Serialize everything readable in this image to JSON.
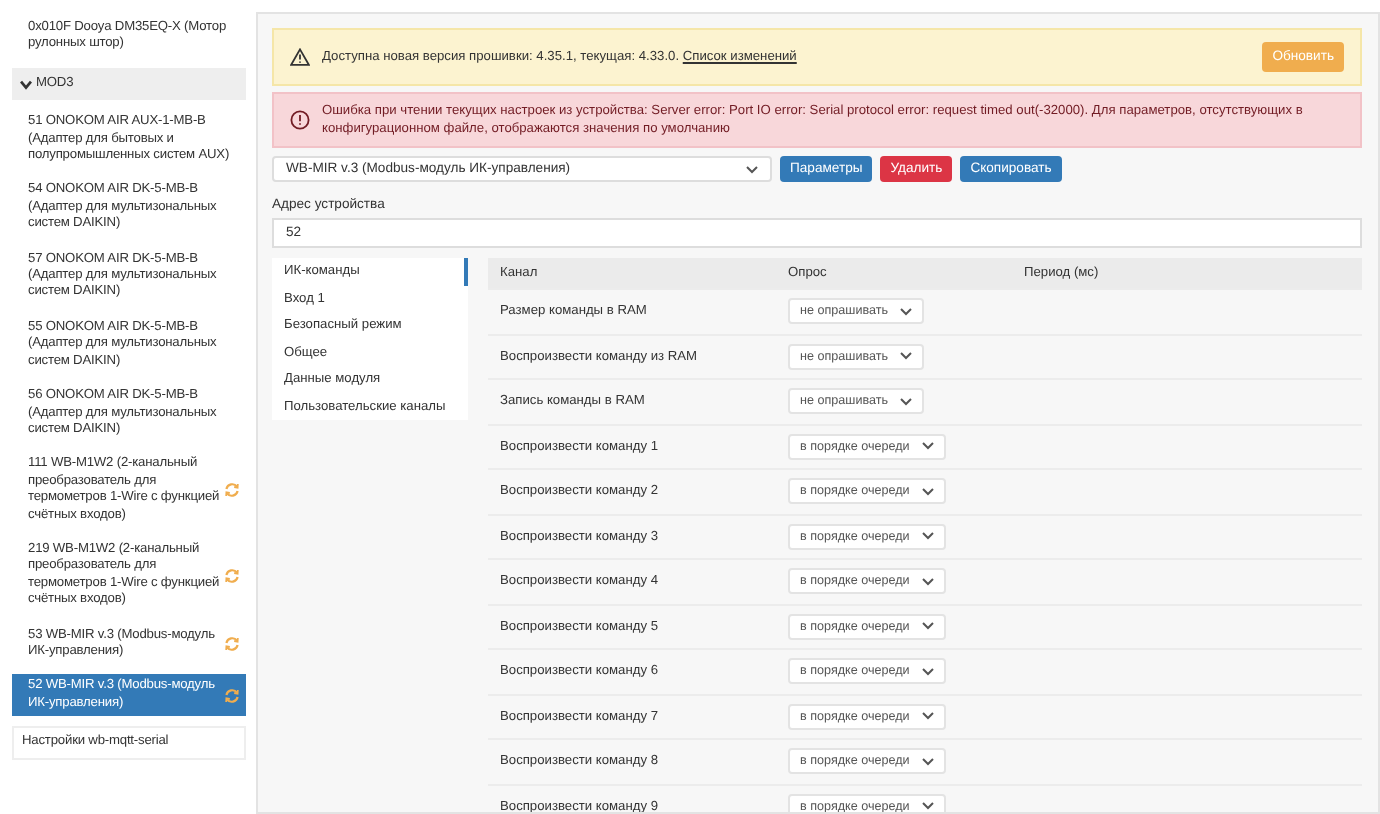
{
  "sidebar": {
    "items": [
      {
        "kind": "device",
        "label": "0x010F Dooya DM35EQ-X (Мотор рулонных штор)",
        "selected": false,
        "syncing": false
      },
      {
        "kind": "group",
        "label": "MOD3",
        "expanded": true,
        "selected": false,
        "syncing": false
      },
      {
        "kind": "device",
        "label": "51 ONOKOM AIR AUX-1-MB-B (Адаптер для бытовых и полупромышленных систем AUX)",
        "selected": false,
        "syncing": false
      },
      {
        "kind": "device",
        "label": "54 ONOKOM AIR DK-5-MB-B (Адаптер для мультизональных систем DAIKIN)",
        "selected": false,
        "syncing": false
      },
      {
        "kind": "device",
        "label": "57 ONOKOM AIR DK-5-MB-B (Адаптер для мультизональных систем DAIKIN)",
        "selected": false,
        "syncing": false
      },
      {
        "kind": "device",
        "label": "55 ONOKOM AIR DK-5-MB-B (Адаптер для мультизональных систем DAIKIN)",
        "selected": false,
        "syncing": false
      },
      {
        "kind": "device",
        "label": "56 ONOKOM AIR DK-5-MB-B (Адаптер для мультизональных систем DAIKIN)",
        "selected": false,
        "syncing": false
      },
      {
        "kind": "device",
        "label": "111 WB-M1W2 (2-канальный преобразователь для термометров 1-Wire с функцией счётных входов)",
        "selected": false,
        "syncing": true
      },
      {
        "kind": "device",
        "label": "219 WB-M1W2 (2-канальный преобразователь для термометров 1-Wire с функцией счётных входов)",
        "selected": false,
        "syncing": true
      },
      {
        "kind": "device",
        "label": "53 WB-MIR v.3 (Modbus-модуль ИК-управления)",
        "selected": false,
        "syncing": true
      },
      {
        "kind": "device",
        "label": "52 WB-MIR v.3 (Modbus-модуль ИК-управления)",
        "selected": true,
        "syncing": true
      },
      {
        "kind": "link",
        "label": "Настройки wb-mqtt-serial",
        "selected": false,
        "syncing": false
      }
    ]
  },
  "alerts": [
    {
      "kind": "warning",
      "text": "Доступна новая версия прошивки: 4.35.1, текущая: 4.33.0.",
      "link": "Список изменений",
      "button": "Обновить"
    },
    {
      "kind": "danger",
      "text": "Ошибка при чтении текущих настроек из устройства: Server error: Port IO error: Serial protocol error: request timed out(-32000). Для параметров, отсутствующих в конфигурационном файле, отображаются значения по умолчанию"
    }
  ],
  "device_type": {
    "value": "WB-MIR v.3 (Modbus-модуль ИК-управления)"
  },
  "actions": [
    {
      "kind": "primary",
      "label": "Параметры"
    },
    {
      "kind": "danger",
      "label": "Удалить"
    },
    {
      "kind": "primary",
      "label": "Скопировать"
    }
  ],
  "address": {
    "label": "Адрес устройства",
    "value": "52"
  },
  "tabs": [
    {
      "label": "ИК-команды",
      "selected": true
    },
    {
      "label": "Вход 1",
      "selected": false
    },
    {
      "label": "Безопасный режим",
      "selected": false
    },
    {
      "label": "Общее",
      "selected": false
    },
    {
      "label": "Данные модуля",
      "selected": false
    },
    {
      "label": "Пользовательские каналы",
      "selected": false
    }
  ],
  "table": {
    "columns": [
      "Канал",
      "Опрос",
      "Период (мс)"
    ],
    "rows": [
      {
        "channel": "Размер команды в RAM",
        "poll": "не опрашивать"
      },
      {
        "channel": "Воспроизвести команду из RAM",
        "poll": "не опрашивать"
      },
      {
        "channel": "Запись команды в RAM",
        "poll": "не опрашивать"
      },
      {
        "channel": "Воспроизвести команду 1",
        "poll": "в порядке очереди"
      },
      {
        "channel": "Воспроизвести команду 2",
        "poll": "в порядке очереди"
      },
      {
        "channel": "Воспроизвести команду 3",
        "poll": "в порядке очереди"
      },
      {
        "channel": "Воспроизвести команду 4",
        "poll": "в порядке очереди"
      },
      {
        "channel": "Воспроизвести команду 5",
        "poll": "в порядке очереди"
      },
      {
        "channel": "Воспроизвести команду 6",
        "poll": "в порядке очереди"
      },
      {
        "channel": "Воспроизвести команду 7",
        "poll": "в порядке очереди"
      },
      {
        "channel": "Воспроизвести команду 8",
        "poll": "в порядке очереди"
      },
      {
        "channel": "Воспроизвести команду 9",
        "poll": "в порядке очереди"
      }
    ]
  }
}
